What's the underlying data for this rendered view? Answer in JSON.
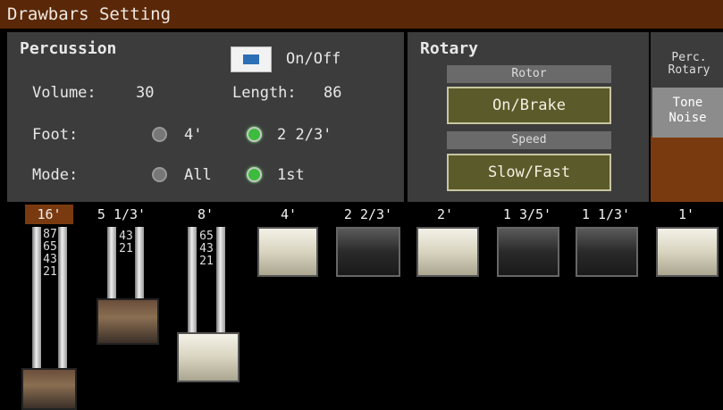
{
  "title": "Drawbars Setting",
  "percussion": {
    "heading": "Percussion",
    "onoff_label": "On/Off",
    "volume_label": "Volume:",
    "volume_value": "30",
    "length_label": "Length:",
    "length_value": "86",
    "foot_label": "Foot:",
    "foot_options": [
      "4'",
      "2 2/3'"
    ],
    "foot_selected": "2 2/3'",
    "mode_label": "Mode:",
    "mode_options": [
      "All",
      "1st"
    ],
    "mode_selected": "1st"
  },
  "rotary": {
    "heading": "Rotary",
    "rotor_label": "Rotor",
    "rotor_button": "On/Brake",
    "speed_label": "Speed",
    "speed_button": "Slow/Fast"
  },
  "perc_rotary": {
    "label_line1": "Perc.",
    "label_line2": "Rotary",
    "tone_line1": "Tone",
    "tone_line2": "Noise"
  },
  "footages": [
    "16'",
    "5 1/3'",
    "8'",
    "4'",
    "2 2/3'",
    "2'",
    "1 3/5'",
    "1 1/3'",
    "1'"
  ],
  "selected_footage": "16'",
  "drawbar_levels": [
    8,
    4,
    6,
    0,
    0,
    0,
    0,
    0,
    0
  ],
  "drawbar_scales": {
    "bar1": "87654321",
    "bar2": "4321",
    "bar3": "654321"
  },
  "colors": {
    "title_bar": "#5a2808",
    "panel": "#3c3c3c",
    "accent_brown": "#7a3a0f",
    "radio_on": "#3cbc3c",
    "button_olive": "#5b5a2a"
  }
}
